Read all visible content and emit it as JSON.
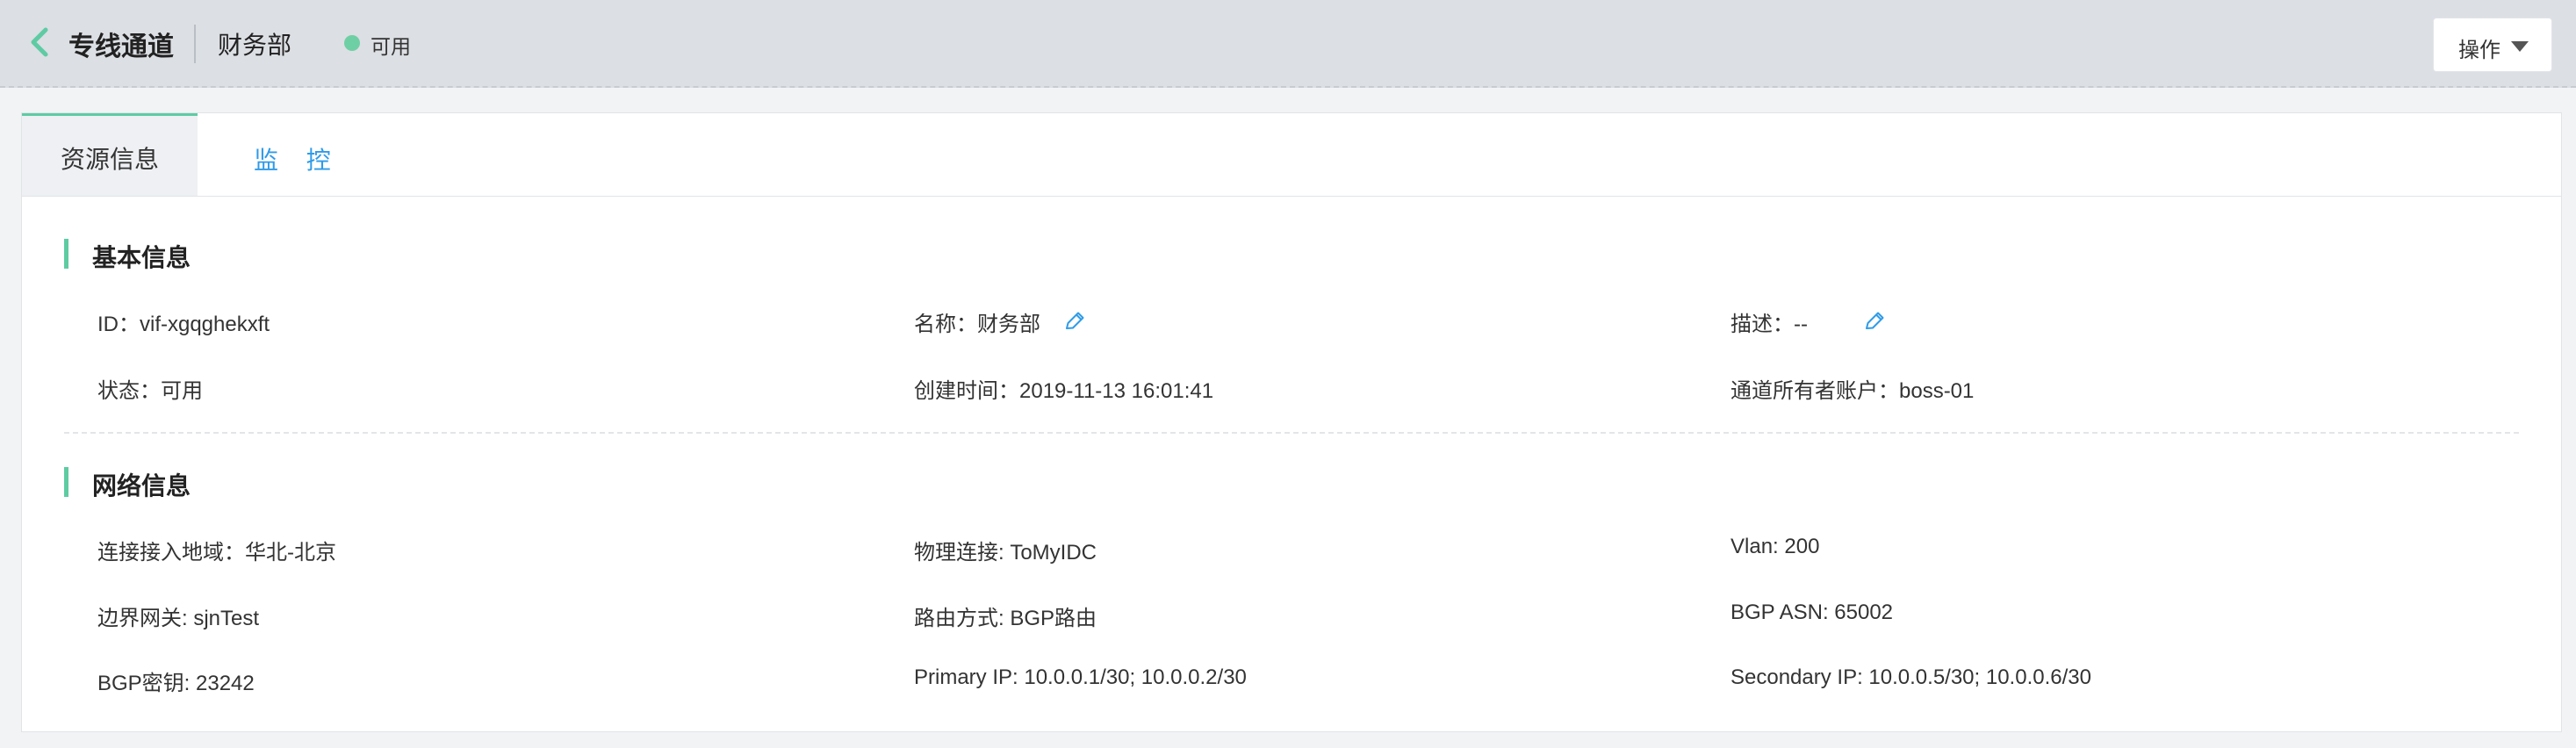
{
  "header": {
    "title": "专线通道",
    "subtitle": "财务部",
    "status": "可用",
    "status_color": "#6fcfa4",
    "back_icon": "chevron-left-icon",
    "actions_label": "操作",
    "actions_icon": "caret-down-icon"
  },
  "tabs": [
    {
      "label": "资源信息",
      "active": true
    },
    {
      "label": "监 控",
      "active": false
    }
  ],
  "accent_color": "#5ecba3",
  "link_color": "#2f9be9",
  "basic_info": {
    "title": "基本信息",
    "id": "ID：vif-xgqghekxft",
    "name": "名称：财务部",
    "description": "描述：--",
    "status": "状态：可用",
    "created": "创建时间：2019-11-13 16:01:41",
    "owner": "通道所有者账户：boss-01",
    "edit_icon": "pencil-icon"
  },
  "network_info": {
    "title": "网络信息",
    "region": "连接接入地域：华北-北京",
    "physical": "物理连接: ToMyIDC",
    "vlan": "Vlan: 200",
    "gateway": "边界网关: sjnTest",
    "routing": "路由方式: BGP路由",
    "bgp_asn": "BGP ASN: 65002",
    "bgp_key": "BGP密钥: 23242",
    "primary_ip": "Primary IP: 10.0.0.1/30; 10.0.0.2/30",
    "secondary_ip": "Secondary IP: 10.0.0.5/30; 10.0.0.6/30"
  }
}
